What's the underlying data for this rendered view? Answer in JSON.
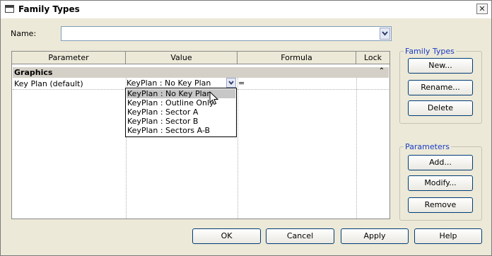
{
  "window": {
    "title": "Family Types",
    "close_glyph": "✕"
  },
  "name_field": {
    "label": "Name:",
    "value": ""
  },
  "grid": {
    "columns": [
      "Parameter",
      "Value",
      "Formula",
      "Lock"
    ],
    "group": {
      "label": "Graphics",
      "toggle_glyph": "⌃"
    },
    "rows": [
      {
        "parameter": "Key Plan (default)",
        "value": "KeyPlan : No Key Plan",
        "formula": "="
      }
    ]
  },
  "dropdown": {
    "options": [
      "KeyPlan : No Key Plan",
      "KeyPlan : Outline Only",
      "KeyPlan : Sector A",
      "KeyPlan : Sector B",
      "KeyPlan : Sectors A-B"
    ],
    "selected_index": 0
  },
  "family_types": {
    "legend": "Family Types",
    "new": "New...",
    "rename": "Rename...",
    "delete": "Delete"
  },
  "parameters": {
    "legend": "Parameters",
    "add": "Add...",
    "modify": "Modify...",
    "remove": "Remove"
  },
  "footer": {
    "ok": "OK",
    "cancel": "Cancel",
    "apply": "Apply",
    "help": "Help"
  },
  "colors": {
    "accent_text": "#1a3cc4",
    "button_border": "#003c74",
    "dialog_bg": "#ece9d8"
  }
}
